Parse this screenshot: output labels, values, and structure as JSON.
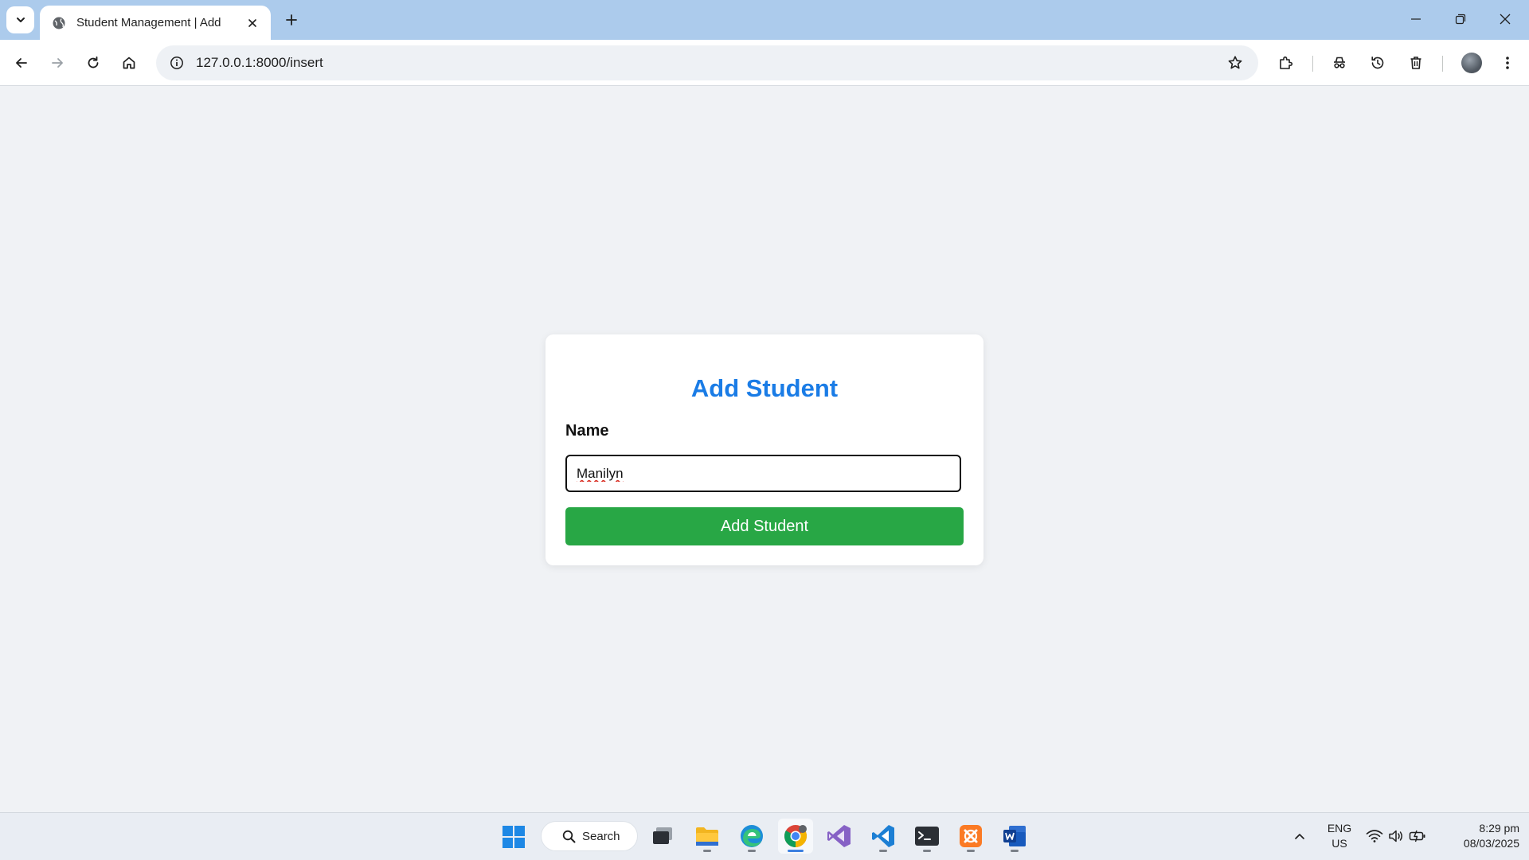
{
  "browser": {
    "tab_title": "Student Management | Add",
    "url": "127.0.0.1:8000/insert"
  },
  "form": {
    "heading": "Add Student",
    "name_label": "Name",
    "name_value": "Manilyn",
    "submit_label": "Add Student",
    "colors": {
      "heading": "#1a7ce6",
      "button": "#28a745"
    }
  },
  "taskbar": {
    "search_label": "Search",
    "apps": [
      "task-view",
      "file-explorer",
      "edge",
      "chrome",
      "visual-studio",
      "vscode",
      "terminal",
      "xampp",
      "word"
    ],
    "language_top": "ENG",
    "language_bottom": "US",
    "time": "8:29 pm",
    "date": "08/03/2025"
  }
}
